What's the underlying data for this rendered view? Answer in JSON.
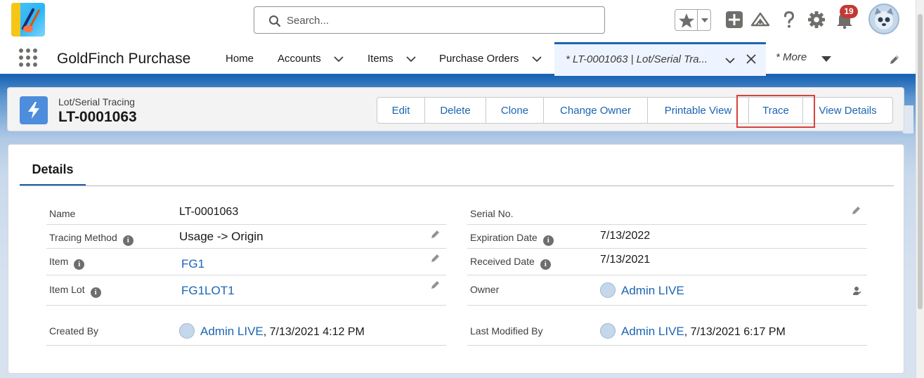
{
  "header": {
    "search_placeholder": "Search...",
    "notification_count": "19"
  },
  "nav": {
    "app_name": "GoldFinch Purchase",
    "items": [
      {
        "label": "Home"
      },
      {
        "label": "Accounts"
      },
      {
        "label": "Items"
      },
      {
        "label": "Purchase Orders"
      }
    ],
    "active_tab_label": "* LT-0001063 | Lot/Serial Tra...",
    "more_label": "* More"
  },
  "record": {
    "type_label": "Lot/Serial Tracing",
    "name": "LT-0001063",
    "actions": [
      {
        "label": "Edit"
      },
      {
        "label": "Delete"
      },
      {
        "label": "Clone"
      },
      {
        "label": "Change Owner"
      },
      {
        "label": "Printable View"
      },
      {
        "label": "Trace"
      },
      {
        "label": "View Details"
      }
    ],
    "highlighted_action": "Trace",
    "accent_color": "#1b64b4",
    "highlight_color": "#d9413c"
  },
  "details": {
    "tab_label": "Details",
    "left": [
      {
        "label": "Name",
        "value": "LT-0001063"
      },
      {
        "label": "Tracing Method",
        "value": "Usage -> Origin"
      },
      {
        "label": "Item",
        "value": "FG1"
      },
      {
        "label": "Item Lot",
        "value": "FG1LOT1"
      },
      {
        "label": "Created By",
        "user": "Admin LIVE",
        "date": ", 7/13/2021 4:12 PM"
      }
    ],
    "right": [
      {
        "label": "Serial No.",
        "value": ""
      },
      {
        "label": "Expiration Date",
        "value": "7/13/2022"
      },
      {
        "label": "Received Date",
        "value": "7/13/2021"
      },
      {
        "label": "Owner",
        "user": "Admin LIVE"
      },
      {
        "label": "Last Modified By",
        "user": "Admin LIVE",
        "date": ", 7/13/2021 6:17 PM"
      }
    ],
    "info_glyph": "i"
  }
}
